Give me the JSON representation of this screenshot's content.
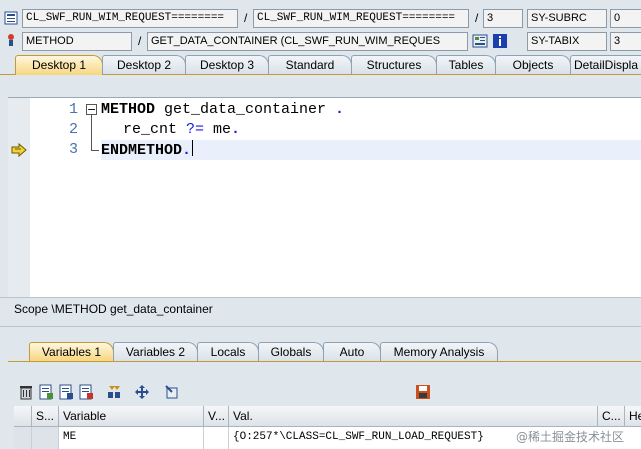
{
  "header": {
    "row1": {
      "class_field": "CL_SWF_RUN_WIM_REQUEST========",
      "class_field2": "CL_SWF_RUN_WIM_REQUEST========",
      "separator": "/",
      "separator2": "/",
      "line": "3",
      "sysvar": "SY-SUBRC",
      "sysval": "0"
    },
    "row2": {
      "type_field": "METHOD",
      "separator": "/",
      "method_field": "GET_DATA_CONTAINER (CL_SWF_RUN_WIM_REQUES",
      "sysvar": "SY-TABIX",
      "sysval": "3"
    }
  },
  "tabs": [
    {
      "label": "Desktop 1",
      "active": true
    },
    {
      "label": "Desktop 2"
    },
    {
      "label": "Desktop 3"
    },
    {
      "label": "Standard"
    },
    {
      "label": "Structures"
    },
    {
      "label": "Tables"
    },
    {
      "label": "Objects"
    },
    {
      "label": "DetailDispla"
    }
  ],
  "editor": {
    "lines": [
      {
        "num": "1",
        "kw": "METHOD",
        "rest": " get_data_container ",
        "end": "."
      },
      {
        "num": "2",
        "text": "re_cnt ",
        "op": "?=",
        "rest2": " me",
        "end": "."
      },
      {
        "num": "3",
        "kw": "ENDMETHOD",
        "end": "."
      }
    ],
    "collapse_glyph": "−"
  },
  "scope": "Scope \\METHOD get_data_container",
  "subtabs": [
    {
      "label": "Variables 1",
      "active": true
    },
    {
      "label": "Variables 2"
    },
    {
      "label": "Locals"
    },
    {
      "label": "Globals"
    },
    {
      "label": "Auto"
    },
    {
      "label": "Memory Analysis"
    }
  ],
  "table": {
    "headers": [
      "S...",
      "Variable",
      "V...",
      "Val.",
      "C...",
      "He"
    ],
    "row": {
      "variable": "ME",
      "value": "{O:257*\\CLASS=CL_SWF_RUN_LOAD_REQUEST}"
    }
  },
  "watermark": "@稀土掘金技术社区",
  "colors": {
    "accent": "#f6d680",
    "background": "#dfe6ec",
    "keyword_blue": "#1a1ae6"
  }
}
